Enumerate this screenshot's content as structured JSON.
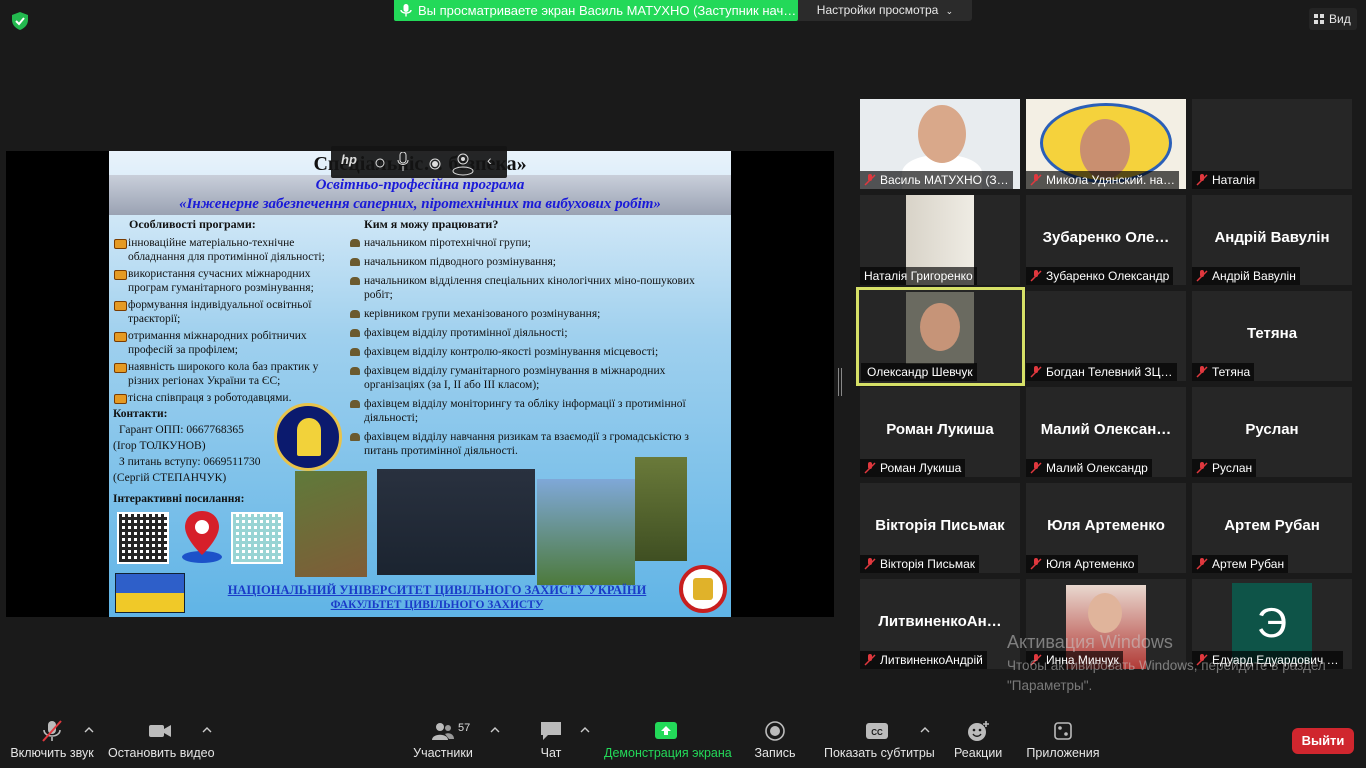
{
  "topbar": {
    "share_banner": "Вы просматриваете экран Василь МАТУХНО (Заступник нач…",
    "view_settings": "Настройки просмотра",
    "view_button": "Вид"
  },
  "slide": {
    "title": "Спеціальніс… безпека»",
    "subtitle1": "Освітньо-професійна програма",
    "subtitle2": "«Інженерне забезпечення саперних, піротехнічних та вибухових робіт»",
    "features_heading": "Особливості програми:",
    "features": [
      "інноваційне матеріально-технічне обладнання для протимінної діяльності;",
      "використання сучасних міжнародних програм гуманітарного розмінування;",
      "формування індивідуальної освітньої траєкторії;",
      "отримання міжнародних робітничих професій за профілем;",
      "наявність широкого кола баз практик у різних регіонах України та ЄС;",
      "тісна співпраця з роботодавцями."
    ],
    "jobs_heading": "Ким я можу працювати?",
    "jobs": [
      "начальником піротехнічної групи;",
      "начальником підводного розмінування;",
      "начальником відділення спеціальних кінологічних міно-пошукових робіт;",
      "керівником групи механізованого розмінування;",
      "фахівцем відділу протимінної діяльності;",
      "фахівцем відділу контролю-якості розмінування місцевості;",
      "фахівцем відділу гуманітарного розмінування в міжнародних організаціях (за І, ІІ або ІІІ класом);",
      "фахівцем відділу моніторингу та обліку інформації з протимінної діяльності;",
      "фахівцем відділу навчання ризикам та взаємодії з громадськістю з питань протимінної діяльності."
    ],
    "contacts_heading": "Контакти:",
    "contacts": [
      "Гарант ОПП: 0667768365",
      "(Ігор ТОЛКУНОВ)",
      "З питань вступу: 0669511730",
      "(Сергій СТЕПАНЧУК)"
    ],
    "interactive_heading": "Інтерактивні посилання:",
    "footer1": "НАЦІОНАЛЬНИЙ УНІВЕРСИТЕТ ЦИВІЛЬНОГО ЗАХИСТУ УКРАЇНИ",
    "footer2": "ФАКУЛЬТЕТ ЦИВІЛЬНОГО ЗАХИСТУ"
  },
  "participants": [
    {
      "label": "Василь МАТУХНО (З…",
      "big": "",
      "video": true
    },
    {
      "label": "Микола Удянский. на…",
      "big": "",
      "video": true
    },
    {
      "label": "Наталія",
      "big": "",
      "video": false
    },
    {
      "label": "Наталія Григоренко",
      "big": "",
      "video": true
    },
    {
      "label": "Зубаренко Олександр",
      "big": "Зубаренко Оле…",
      "video": false
    },
    {
      "label": "Андрій Вавулін",
      "big": "Андрій Вавулін",
      "video": false
    },
    {
      "label": "Олександр Шевчук",
      "big": "",
      "video": true
    },
    {
      "label": "Богдан Телевний ЗЦ…",
      "big": "",
      "video": false
    },
    {
      "label": "Тетяна",
      "big": "Тетяна",
      "video": false
    },
    {
      "label": "Роман Лукиша",
      "big": "Роман Лукиша",
      "video": false
    },
    {
      "label": "Малий Олександр",
      "big": "Малий Олексан…",
      "video": false
    },
    {
      "label": "Руслан",
      "big": "Руслан",
      "video": false
    },
    {
      "label": "Вікторія Письмак",
      "big": "Вікторія Письмак",
      "video": false
    },
    {
      "label": "Юля Артеменко",
      "big": "Юля Артеменко",
      "video": false
    },
    {
      "label": "Артем Рубан",
      "big": "Артем Рубан",
      "video": false
    },
    {
      "label": "ЛитвиненкоАндрій",
      "big": "ЛитвиненкоАн…",
      "video": false
    },
    {
      "label": "Инна Минчук",
      "big": "",
      "video": true
    },
    {
      "label": "Едуард Едуардович …",
      "big": "",
      "avatar": "Э"
    }
  ],
  "watermark": {
    "title": "Активация Windows",
    "text": "Чтобы активировать Windows, перейдите в раздел \"Параметры\"."
  },
  "toolbar": {
    "mute": "Включить звук",
    "video": "Остановить видео",
    "participants": "Участники",
    "participants_count": "57",
    "chat": "Чат",
    "share": "Демонстрация экрана",
    "record": "Запись",
    "captions": "Показать субтитры",
    "reactions": "Реакции",
    "apps": "Приложения",
    "leave": "Выйти"
  },
  "colors": {
    "share_green": "#23d959",
    "leave_red": "#d0262e",
    "active_speaker": "#d6e067",
    "muted_red": "#e0383e"
  }
}
